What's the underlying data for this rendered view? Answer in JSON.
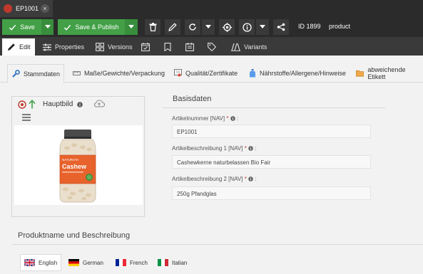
{
  "document_tab": {
    "title": "EP1001",
    "close": "×"
  },
  "toolbar": {
    "save_label": "Save",
    "save_publish_label": "Save & Publish",
    "id_label": "ID 1899",
    "type_label": "product"
  },
  "subtabs": [
    {
      "label": "Edit",
      "icon": "pencil-icon"
    },
    {
      "label": "Properties",
      "icon": "sliders-icon"
    },
    {
      "label": "Versions",
      "icon": "versions-icon"
    },
    {
      "label": "",
      "icon": "calendar-check-icon"
    },
    {
      "label": "",
      "icon": "bookmark-icon"
    },
    {
      "label": "",
      "icon": "notes-icon"
    },
    {
      "label": "",
      "icon": "tag-icon"
    },
    {
      "label": "Variants",
      "icon": "variants-icon"
    }
  ],
  "content_tabs": [
    {
      "label": "Stammdaten",
      "icon": "wrench-icon"
    },
    {
      "label": "Maße/Gewichte/Verpackung",
      "icon": "ruler-icon"
    },
    {
      "label": "Qualität/Zertifikate",
      "icon": "certificate-icon"
    },
    {
      "label": "Nährstoffe/Allergene/Hinweise",
      "icon": "bottle-icon"
    },
    {
      "label": "abweichende Etikett",
      "icon": "folder-icon"
    }
  ],
  "image_panel": {
    "title": "Hauptbild",
    "product_brand": "NATURATA",
    "product_name": "Cashew",
    "accent_colors": {
      "jar_lid": "#4a4a4a",
      "label": "#e8622c",
      "nuts": "#eadfcc"
    }
  },
  "basisdaten": {
    "title": "Basisdaten",
    "fields": [
      {
        "label": "Artikelnummer [NAV]",
        "value": "EP1001"
      },
      {
        "label": "Artikelbeschreibung 1 [NAV]",
        "value": "Cashewkerne naturbelassen Bio Fair"
      },
      {
        "label": "Artikelbeschreibung 2 [NAV]",
        "value": "250g Pfandglas"
      }
    ],
    "required_mark": "*",
    "colon": ":"
  },
  "produktname": {
    "title": "Produktname und Beschreibung",
    "languages": [
      {
        "label": "English",
        "flag": "uk-flag-icon"
      },
      {
        "label": "German",
        "flag": "german-flag-icon"
      },
      {
        "label": "French",
        "flag": "french-flag-icon"
      },
      {
        "label": "Italian",
        "flag": "italian-flag-icon"
      }
    ]
  },
  "colors": {
    "green": "#43a047",
    "toolbar_bg": "#2b2b2b",
    "required": "#c0392b"
  }
}
